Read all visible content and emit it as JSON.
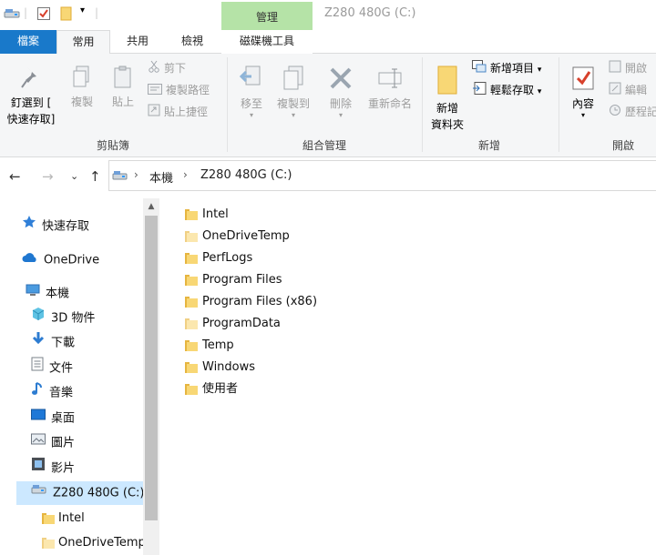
{
  "window": {
    "title": "Z280 480G (C:)",
    "context_tab": "管理"
  },
  "quick_access_toolbar": [
    "drive-icon",
    "properties-check-icon",
    "new-folder-icon",
    "customize-dropdown-icon"
  ],
  "tabs": {
    "file": "檔案",
    "home": "常用",
    "share": "共用",
    "view": "檢視",
    "drive_tools": "磁碟機工具"
  },
  "ribbon": {
    "clipboard": {
      "label": "剪貼簿",
      "pin": "釘選到 [\n快速存取]",
      "copy": "複製",
      "paste": "貼上",
      "cut": "剪下",
      "copy_path": "複製路徑",
      "paste_shortcut": "貼上捷徑"
    },
    "organize": {
      "label": "組合管理",
      "move_to": "移至",
      "copy_to": "複製到",
      "delete": "刪除",
      "rename": "重新命名"
    },
    "new": {
      "label": "新增",
      "new_folder": "新增\n資料夾",
      "new_item": "新增項目",
      "easy_access": "輕鬆存取"
    },
    "open": {
      "label": "開啟",
      "properties": "內容",
      "open": "開啟",
      "edit": "編輯",
      "history": "歷程記錄"
    }
  },
  "address": {
    "crumbs": [
      "本機",
      "Z280 480G (C:)"
    ]
  },
  "nav_pane": {
    "items": [
      {
        "label": "快速存取",
        "icon": "star-icon"
      },
      {
        "label": "OneDrive",
        "icon": "cloud-icon"
      },
      {
        "label": "本機",
        "icon": "computer-icon"
      },
      {
        "label": "3D 物件",
        "icon": "cube-icon"
      },
      {
        "label": "下載",
        "icon": "download-icon"
      },
      {
        "label": "文件",
        "icon": "document-icon"
      },
      {
        "label": "音樂",
        "icon": "music-icon"
      },
      {
        "label": "桌面",
        "icon": "desktop-icon"
      },
      {
        "label": "圖片",
        "icon": "picture-icon"
      },
      {
        "label": "影片",
        "icon": "video-icon"
      },
      {
        "label": "Z280 480G (C:)",
        "icon": "drive-icon"
      },
      {
        "label": "Intel",
        "icon": "folder-icon"
      },
      {
        "label": "OneDriveTemp",
        "icon": "folder-icon"
      }
    ]
  },
  "files": [
    {
      "name": "Intel"
    },
    {
      "name": "OneDriveTemp"
    },
    {
      "name": "PerfLogs"
    },
    {
      "name": "Program Files"
    },
    {
      "name": "Program Files (x86)"
    },
    {
      "name": "ProgramData"
    },
    {
      "name": "Temp"
    },
    {
      "name": "Windows"
    },
    {
      "name": "使用者"
    }
  ],
  "colors": {
    "file_tab": "#1979ca",
    "manage_tab": "#b5e3a7",
    "folder": "#f8d775",
    "selection": "#cce8ff"
  }
}
